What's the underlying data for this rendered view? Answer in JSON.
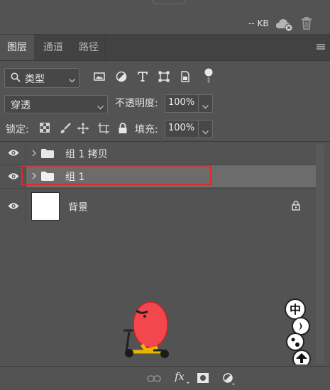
{
  "header": {
    "storage_label": "-- KB"
  },
  "tabs": [
    {
      "label": "图层",
      "active": true
    },
    {
      "label": "通道",
      "active": false
    },
    {
      "label": "路径",
      "active": false
    }
  ],
  "filter": {
    "kind_label": "类型"
  },
  "blend": {
    "mode": "穿透",
    "opacity_label": "不透明度:",
    "opacity_value": "100%"
  },
  "lock": {
    "label": "锁定:",
    "fill_label": "填充:",
    "fill_value": "100%"
  },
  "layers": [
    {
      "name": "组 1 拷贝",
      "type": "group",
      "visible": true,
      "selected": false
    },
    {
      "name": "组 1",
      "type": "group",
      "visible": true,
      "selected": true
    },
    {
      "name": "背景",
      "type": "image",
      "visible": true,
      "selected": false,
      "locked": true
    }
  ],
  "colors": {
    "panel_bg": "#535353",
    "selected_row": "#6c6c6c",
    "highlight": "#d92b2b",
    "tab_bar": "#424242"
  },
  "icons": [
    "cloud-icon",
    "trash-icon",
    "panel-menu-icon",
    "search-icon",
    "image-filter-icon",
    "adjustment-filter-icon",
    "text-filter-icon",
    "shape-filter-icon",
    "smartobject-filter-icon",
    "filter-toggle-icon",
    "lock-transparent-icon",
    "lock-paint-icon",
    "lock-move-icon",
    "lock-artboard-icon",
    "lock-all-icon",
    "eye-icon",
    "folder-icon",
    "link-icon",
    "fx-icon",
    "mask-icon",
    "adjustment-icon"
  ]
}
